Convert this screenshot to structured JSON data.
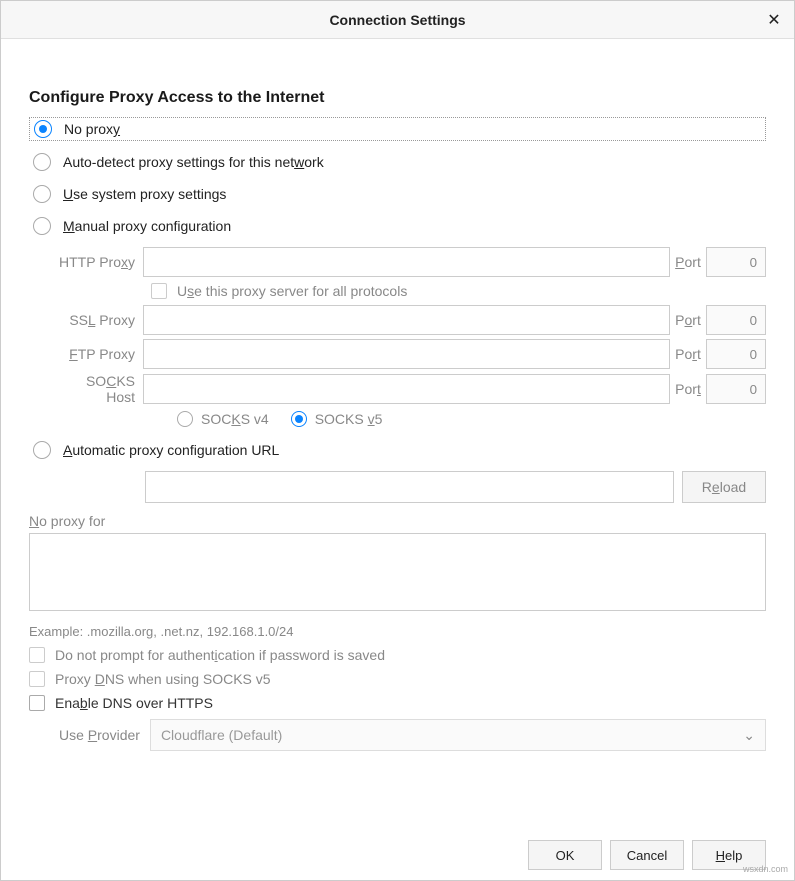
{
  "title": "Connection Settings",
  "section_title": "Configure Proxy Access to the Internet",
  "radios": {
    "no_proxy": "No proxy",
    "auto_detect": "Auto-detect proxy settings for this network",
    "use_system": "Use system proxy settings",
    "manual": "Manual proxy configuration",
    "auto_url": "Automatic proxy configuration URL"
  },
  "proxy": {
    "http_label": "HTTP Proxy",
    "ssl_label": "SSL Proxy",
    "ftp_label": "FTP Proxy",
    "socks_label": "SOCKS Host",
    "port_label": "Port",
    "port_value": "0",
    "use_all": "Use this proxy server for all protocols",
    "socks_v4": "SOCKS v4",
    "socks_v5": "SOCKS v5"
  },
  "reload_label": "Reload",
  "no_proxy_for_label": "No proxy for",
  "example_text": "Example: .mozilla.org, .net.nz, 192.168.1.0/24",
  "opts": {
    "no_prompt": "Do not prompt for authentication if password is saved",
    "proxy_dns": "Proxy DNS when using SOCKS v5",
    "enable_doh": "Enable DNS over HTTPS"
  },
  "provider": {
    "label": "Use Provider",
    "value": "Cloudflare (Default)"
  },
  "buttons": {
    "ok": "OK",
    "cancel": "Cancel",
    "help": "Help"
  },
  "watermark": "wsxdn.com"
}
